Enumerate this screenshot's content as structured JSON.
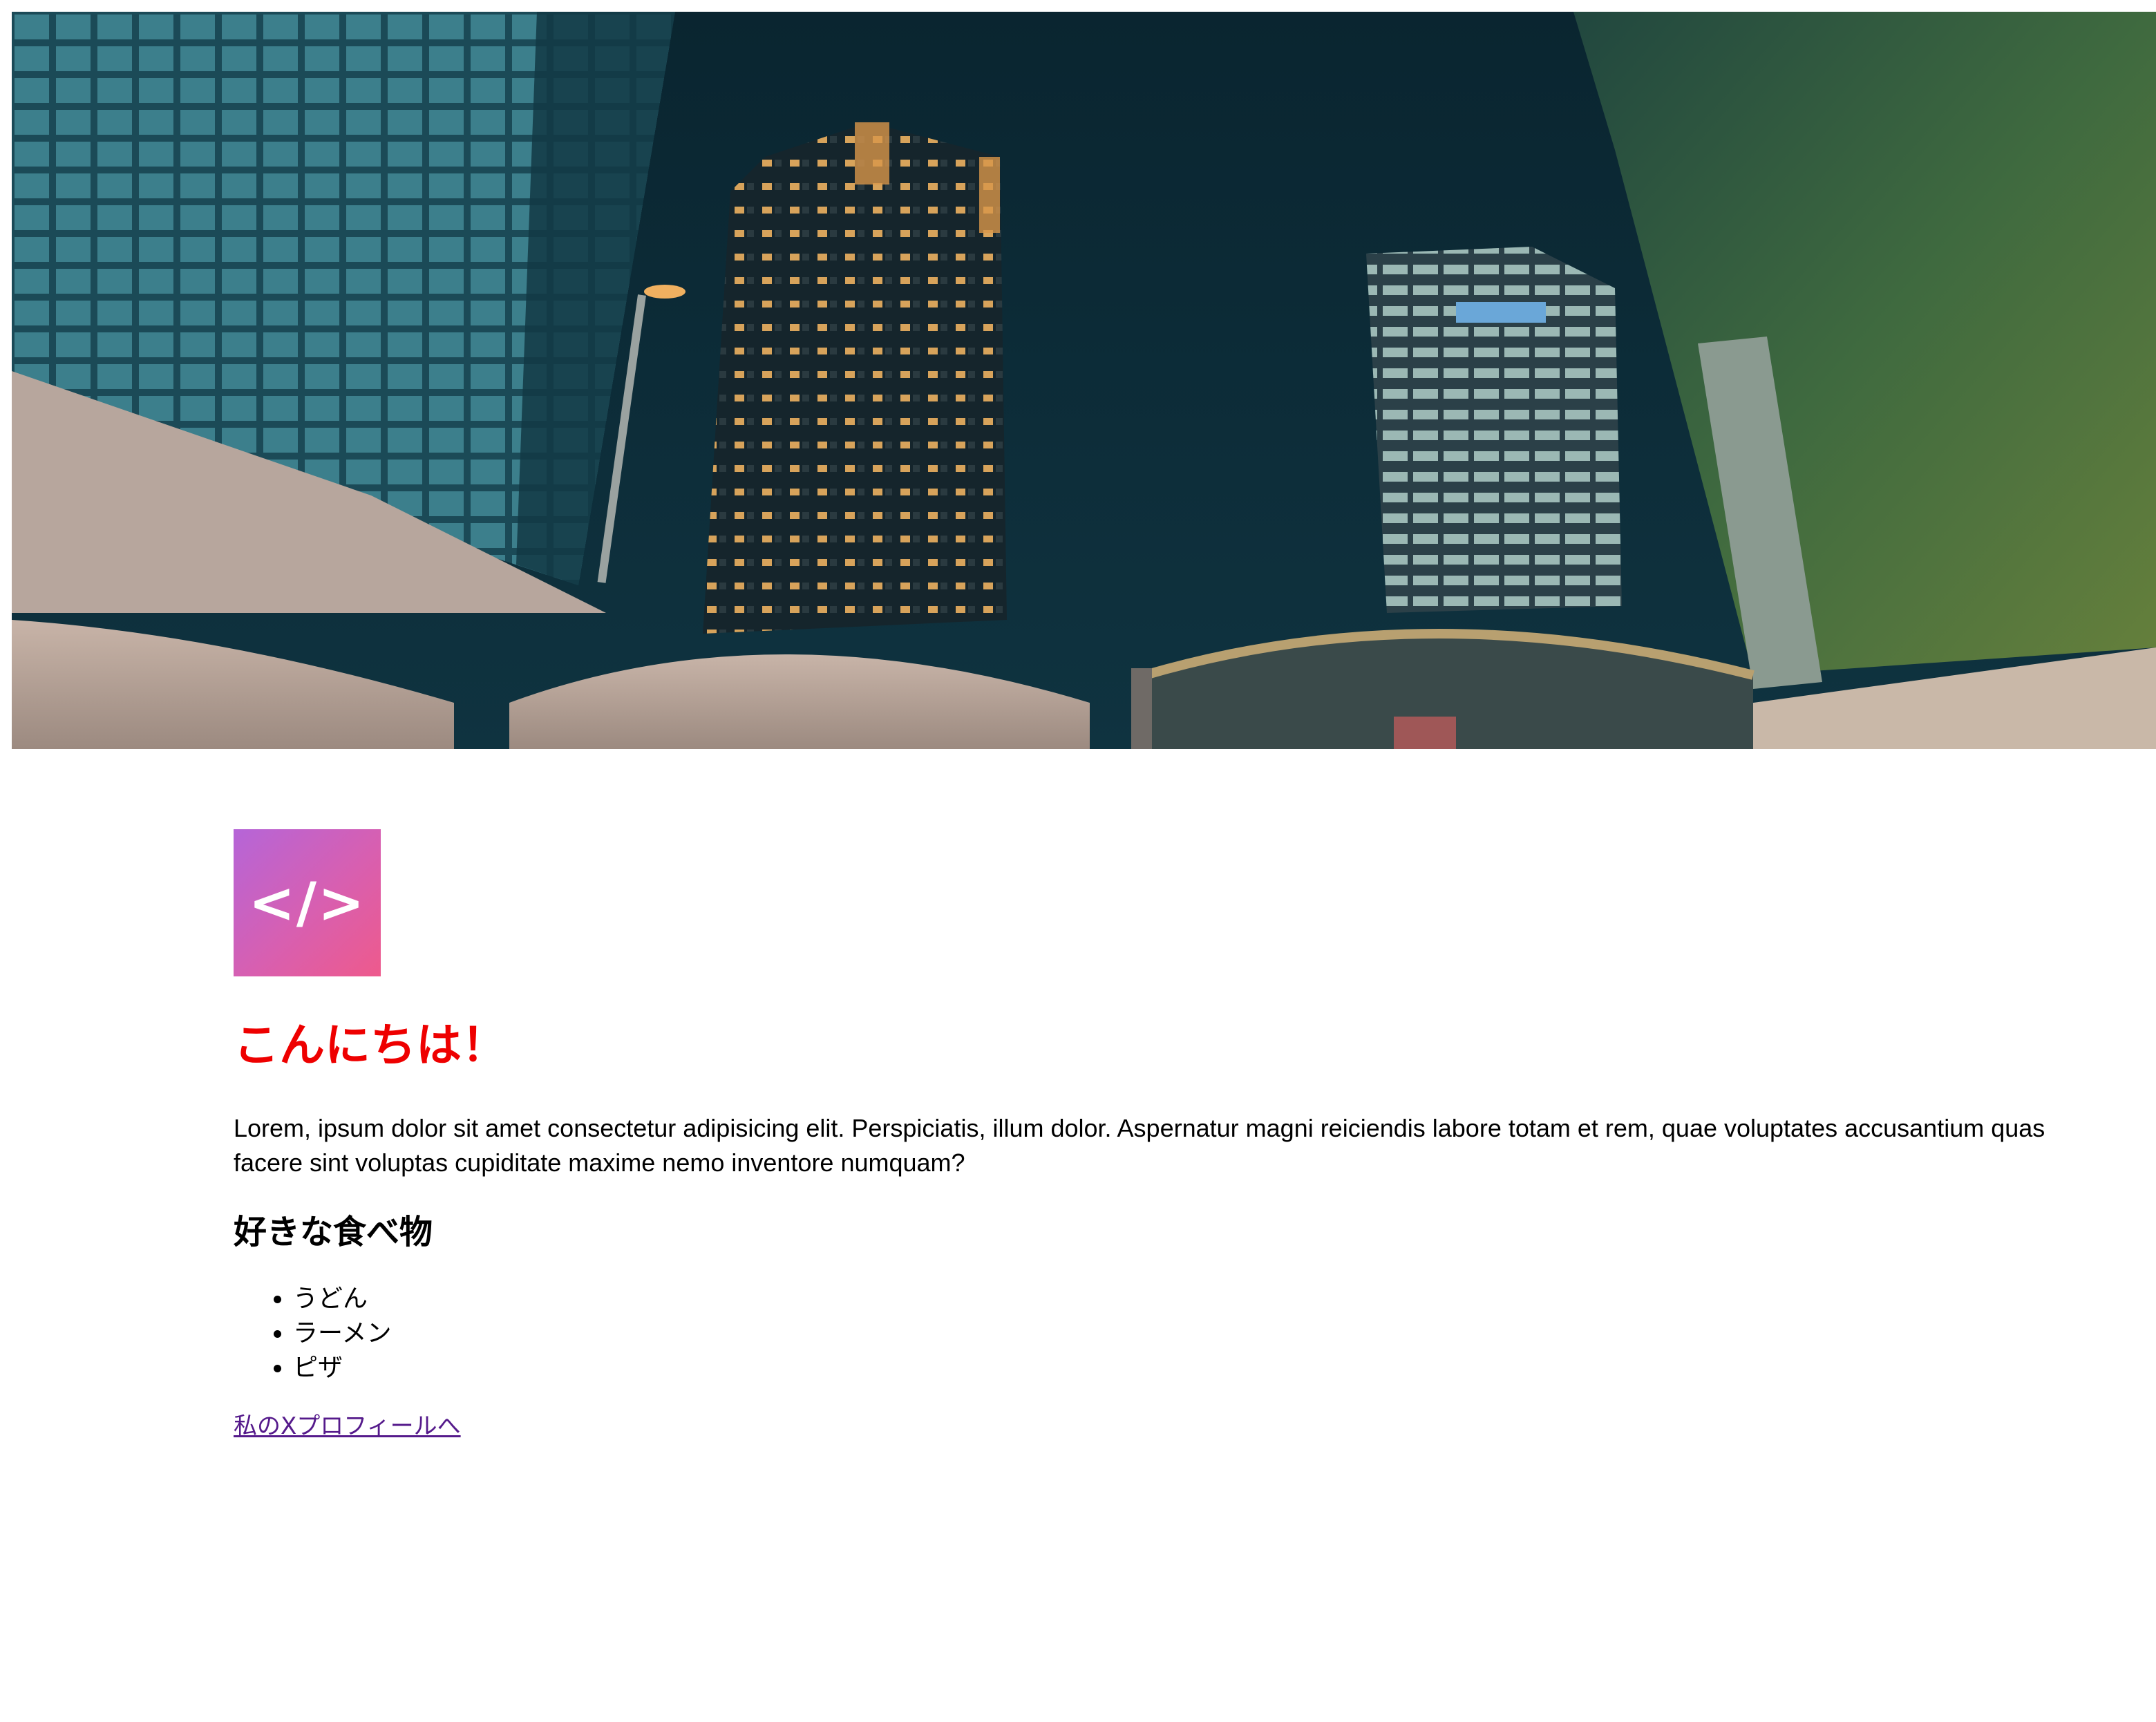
{
  "hero": {
    "image": "night-city-skyscrapers-photo"
  },
  "logo": {
    "glyph": "</>",
    "icon": "code-icon",
    "gradient": [
      "#b565d8",
      "#ee5a8c"
    ]
  },
  "main": {
    "title": "こんにちは！",
    "title_color": "#ee0000",
    "lead": "Lorem, ipsum dolor sit amet consectetur adipisicing elit. Perspiciatis, illum dolor. Aspernatur magni reiciendis labore totam et rem, quae voluptates accusantium quas facere sint voluptas cupiditate maxime nemo inventore numquam?",
    "foods_heading": "好きな食べ物",
    "foods": [
      "うどん",
      "ラーメン",
      "ピザ"
    ],
    "profile_link": "私のXプロフィールへ"
  }
}
